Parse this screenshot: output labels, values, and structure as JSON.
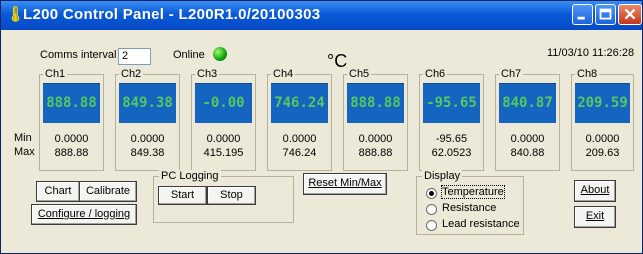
{
  "window": {
    "title": "L200 Control Panel - L200R1.0/20100303"
  },
  "header": {
    "comms_label": "Comms interval",
    "comms_value": "2",
    "online_label": "Online",
    "unit": "°C",
    "datetime": "11/03/10 11:26:28"
  },
  "row_labels": {
    "min": "Min",
    "max": "Max"
  },
  "channels": [
    {
      "name": "Ch1",
      "reading": "888.88",
      "min": "0.0000",
      "max": "888.88"
    },
    {
      "name": "Ch2",
      "reading": "849.38",
      "min": "0.0000",
      "max": "849.38"
    },
    {
      "name": "Ch3",
      "reading": "-0.00",
      "min": "0.0000",
      "max": "415.195"
    },
    {
      "name": "Ch4",
      "reading": "746.24",
      "min": "0.0000",
      "max": "746.24"
    },
    {
      "name": "Ch5",
      "reading": "888.88",
      "min": "0.0000",
      "max": "888.88"
    },
    {
      "name": "Ch6",
      "reading": "-95.65",
      "min": "-95.65",
      "max": "62.0523"
    },
    {
      "name": "Ch7",
      "reading": "840.87",
      "min": "0.0000",
      "max": "840.88"
    },
    {
      "name": "Ch8",
      "reading": "209.59",
      "min": "0.0000",
      "max": "209.63"
    }
  ],
  "buttons": {
    "chart": "Chart",
    "calibrate": "Calibrate",
    "configure": "Configure / logging",
    "reset": "Reset Min/Max",
    "about": "About",
    "exit": "Exit"
  },
  "pc_logging": {
    "title": "PC Logging",
    "start": "Start",
    "stop": "Stop"
  },
  "display": {
    "title": "Display",
    "options": [
      "Temperature",
      "Resistance",
      "Lead resistance"
    ],
    "selected": "Temperature"
  },
  "colors": {
    "title_bar": "#0a5ad8",
    "display_bg": "#1565c0",
    "display_digits": "#55c860",
    "online_led": "#10a010"
  }
}
